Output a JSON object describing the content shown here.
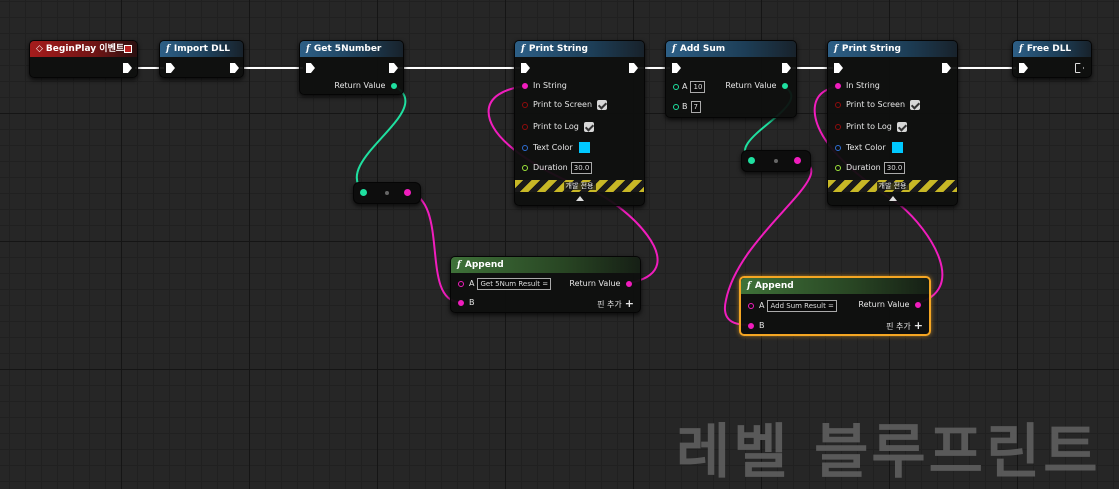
{
  "colors": {
    "exec_wire": "#ffffff",
    "int_pin": "#1fe0a0",
    "string_pin": "#f01dbd",
    "bool_pin": "#8f0c0c",
    "struct_pin": "#2f6fd6",
    "float_pin": "#9fe63a",
    "text_color_swatch": "#00c8ff",
    "selection_outline": "#f5a623"
  },
  "nodes": {
    "begin_play": {
      "title": "BeginPlay 이벤트",
      "icon": "event-diamond-icon"
    },
    "import_dll": {
      "title": "Import DLL",
      "icon": "function-icon"
    },
    "get5number": {
      "title": "Get 5Number",
      "return_label": "Return Value"
    },
    "print1": {
      "title": "Print String",
      "in_string": "In String",
      "print_to_screen": "Print to Screen",
      "print_to_log": "Print to Log",
      "text_color": "Text Color",
      "duration": "Duration",
      "duration_value": "30.0",
      "dev_only": "개발 전용"
    },
    "add_sum": {
      "title": "Add Sum",
      "a_label": "A",
      "a_value": "10",
      "b_label": "B",
      "b_value": "7",
      "return_label": "Return Value"
    },
    "print2": {
      "title": "Print String",
      "in_string": "In String",
      "print_to_screen": "Print to Screen",
      "print_to_log": "Print to Log",
      "text_color": "Text Color",
      "duration": "Duration",
      "duration_value": "30.0",
      "dev_only": "개발 전용"
    },
    "free_dll": {
      "title": "Free DLL"
    },
    "append1": {
      "title": "Append",
      "a_label": "A",
      "a_value": "Get 5Num Result =",
      "b_label": "B",
      "return_label": "Return Value",
      "add_pin": "핀 추가"
    },
    "append2": {
      "title": "Append",
      "a_label": "A",
      "a_value": "Add Sum Result =",
      "b_label": "B",
      "return_label": "Return Value",
      "add_pin": "핀 추가"
    }
  },
  "watermark": "레벨 블루프린트"
}
